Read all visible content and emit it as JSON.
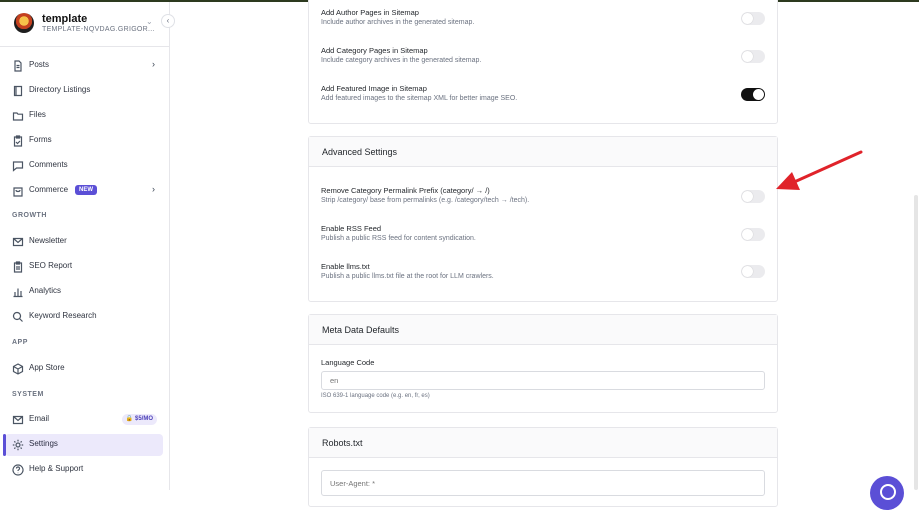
{
  "brand": {
    "title": "template",
    "subtitle": "TEMPLATE-NQVDAG.GRIGOR..."
  },
  "sidebar": {
    "items": [
      {
        "label": "Posts"
      },
      {
        "label": "Directory Listings"
      },
      {
        "label": "Files"
      },
      {
        "label": "Forms"
      },
      {
        "label": "Comments"
      },
      {
        "label": "Commerce",
        "badge": "NEW"
      }
    ],
    "growth_label": "GROWTH",
    "growth_items": [
      {
        "label": "Newsletter"
      },
      {
        "label": "SEO Report"
      },
      {
        "label": "Analytics"
      },
      {
        "label": "Keyword Research"
      }
    ],
    "app_label": "APP",
    "app_items": [
      {
        "label": "App Store"
      }
    ],
    "system_label": "SYSTEM",
    "system_items": [
      {
        "label": "Email",
        "badge": "$5/MO"
      },
      {
        "label": "Settings",
        "active": true
      },
      {
        "label": "Help & Support"
      }
    ]
  },
  "sitemap_rows": [
    {
      "title": "Add Author Pages in Sitemap",
      "desc": "Include author archives in the generated sitemap.",
      "enabled": false
    },
    {
      "title": "Add Category Pages in Sitemap",
      "desc": "Include category archives in the generated sitemap.",
      "enabled": false
    },
    {
      "title": "Add Featured Image in Sitemap",
      "desc": "Add featured images to the sitemap XML for better image SEO.",
      "enabled": true
    }
  ],
  "advanced": {
    "title": "Advanced Settings",
    "rows": [
      {
        "title": "Remove Category Permalink Prefix (category/ → /)",
        "desc": "Strip /category/ base from permalinks (e.g. /category/tech → /tech).",
        "enabled": false
      },
      {
        "title": "Enable RSS Feed",
        "desc": "Publish a public RSS feed for content syndication.",
        "enabled": false
      },
      {
        "title": "Enable llms.txt",
        "desc": "Publish a public llms.txt file at the root for LLM crawlers.",
        "enabled": false
      }
    ]
  },
  "meta": {
    "title": "Meta Data Defaults",
    "language_label": "Language Code",
    "language_placeholder": "en",
    "language_help": "ISO 639-1 language code (e.g. en, fr, es)"
  },
  "robots": {
    "title": "Robots.txt",
    "placeholder": "User-Agent: *"
  },
  "colors": {
    "accent": "#5b4fd6",
    "annotation_arrow": "#e0232a",
    "toggle_on": "#111111",
    "toggle_off": "#ebebee"
  }
}
